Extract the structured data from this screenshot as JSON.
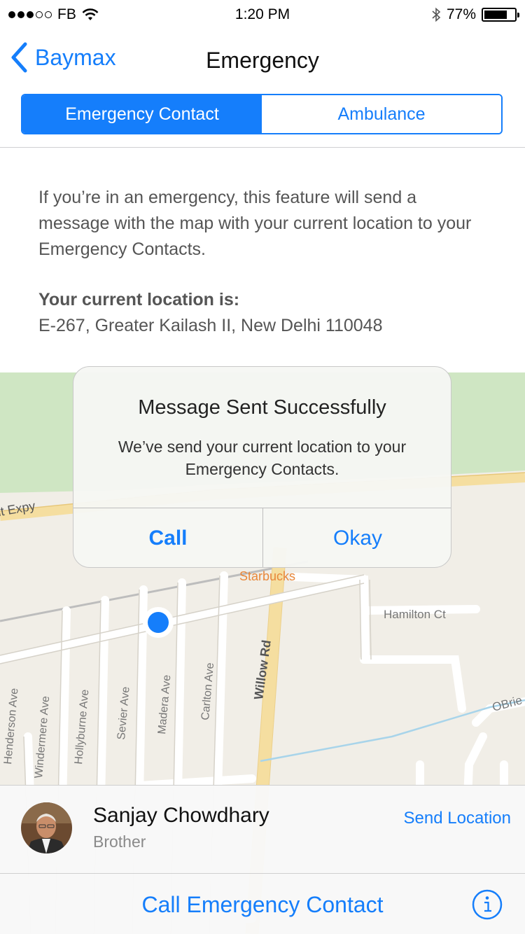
{
  "status_bar": {
    "carrier": "FB",
    "time": "1:20 PM",
    "battery": "77%",
    "battery_level": 0.77,
    "signal_strength": 3,
    "signal_max": 5
  },
  "nav": {
    "back_label": "Baymax",
    "title": "Emergency"
  },
  "segments": [
    {
      "label": "Emergency Contact",
      "selected": true
    },
    {
      "label": "Ambulance",
      "selected": false
    }
  ],
  "body": {
    "info_text": "If you’re in an emergency, this feature will send a message with the map with your current location to your Emergency Contacts.",
    "location_label": "Your current location is:",
    "location_value": "E-267, Greater Kailash II, New Delhi 110048"
  },
  "map": {
    "labels": {
      "expy": "nt Expy",
      "starbucks": "Starbucks",
      "hamilton": "Hamilton Ct",
      "obrien": "OBrie",
      "willow": "Willow Rd",
      "henderson": "Henderson Ave",
      "windermere": "Windermere Ave",
      "hollyburne": "Hollyburne Ave",
      "sevier": "Sevier Ave",
      "madera": "Madera Ave",
      "carlton": "Carlton Ave"
    }
  },
  "alert": {
    "title": "Message Sent Successfully",
    "message": "We’ve send your current location to your Emergency Contacts.",
    "call_label": "Call",
    "okay_label": "Okay"
  },
  "contact": {
    "name": "Sanjay Chowdhary",
    "relation": "Brother",
    "send_location_label": "Send Location"
  },
  "bottom": {
    "call_label": "Call Emergency Contact"
  },
  "colors": {
    "accent": "#157efb",
    "map_bg": "#f1eee7",
    "map_green": "#cfe6c3"
  }
}
